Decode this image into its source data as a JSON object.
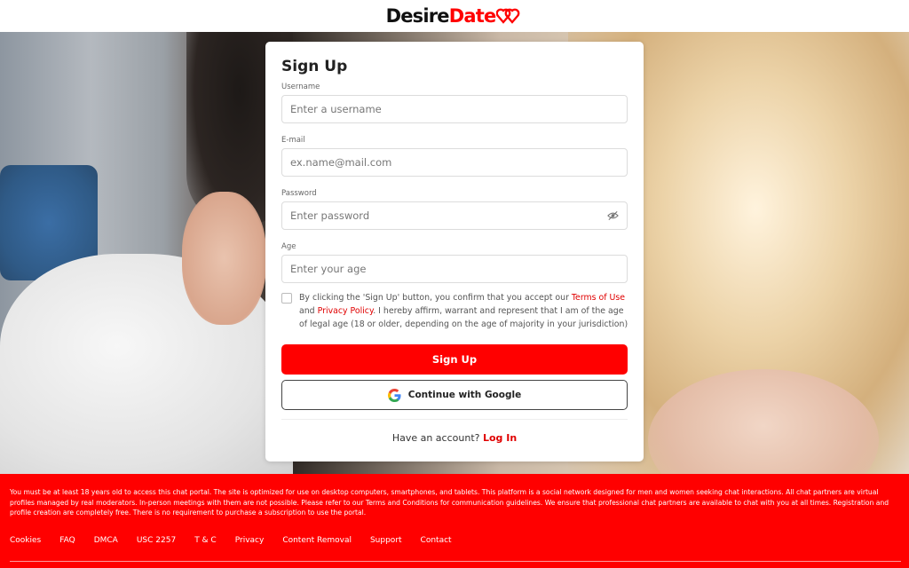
{
  "brand": {
    "part1": "Desire",
    "part2": "Date",
    "accent_color": "#ff0000"
  },
  "form": {
    "title": "Sign Up",
    "username": {
      "label": "Username",
      "placeholder": "Enter a username",
      "value": ""
    },
    "email": {
      "label": "E-mail",
      "placeholder": "ex.name@mail.com",
      "value": ""
    },
    "password": {
      "label": "Password",
      "placeholder": "Enter password",
      "value": "",
      "toggle_icon": "eye-off-icon"
    },
    "age": {
      "label": "Age",
      "placeholder": "Enter your age",
      "value": ""
    },
    "terms": {
      "checked": false,
      "text_1": "By clicking the 'Sign Up' button, you confirm that you accept our ",
      "terms_link": "Terms of Use",
      "text_2": " and ",
      "privacy_link": "Privacy Policy",
      "text_3": ". I hereby affirm, warrant and represent that I am of the age of legal age (18 or older, depending on the age of majority in your jurisdiction)"
    },
    "signup_button": "Sign Up",
    "google_button": "Continue with Google",
    "have_account": "Have an account?",
    "login_link": "Log In"
  },
  "footer": {
    "disclaimer": "You must be at least 18 years old to access this chat portal. The site is optimized for use on desktop computers, smartphones, and tablets. This platform is a social network designed for men and women seeking chat interactions. All chat partners are virtual profiles managed by real moderators. In-person meetings with them are not possible. Please refer to our Terms and Conditions for communication guidelines. We ensure that professional chat partners are available to chat with you at all times. Registration and profile creation are completely free. There is no requirement to purchase a subscription to use the portal.",
    "links": [
      "Cookies",
      "FAQ",
      "DMCA",
      "USC 2257",
      "T & C",
      "Privacy",
      "Content Removal",
      "Support",
      "Contact"
    ]
  }
}
